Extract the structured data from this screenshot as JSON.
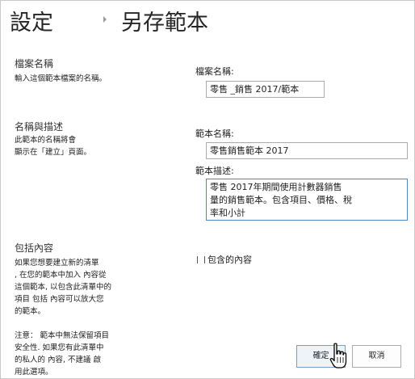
{
  "header": {
    "root": "設定",
    "title": "另存範本"
  },
  "sections": [
    {
      "heading": "檔案名稱",
      "description": [
        "輸入這個範本檔案的名稱。"
      ]
    },
    {
      "heading": "名稱與描述",
      "description": [
        "此範本的名稱將會",
        "顯示在「建立」頁面。"
      ]
    },
    {
      "heading": "包括內容",
      "description": [
        "如果您想要建立新的清單",
        ", 在您的範本中加入 內容從",
        "這個範本, 以包含此清單中的",
        "項目 包括 內容可以放大您",
        "的範本。",
        "",
        "注意：  範本中無法保留項目",
        "安全性. 如果您有此清單中",
        "的私人的 內容, 不建議 啟",
        "用此選項。"
      ]
    }
  ],
  "fields": {
    "file_name": {
      "label": "檔案名稱:",
      "value": "零售 _銷售 2017/範本"
    },
    "template_name": {
      "label": "範本名稱:",
      "value": "零售銷售範本 2017"
    },
    "template_description": {
      "label": "範本描述:",
      "lines": [
        "零售 2017年期間使用計數器銷售",
        "量的銷售範本。包含項目、價格、稅",
        "率和小計"
      ]
    },
    "include_content": {
      "label": "包含的內容",
      "checked": false
    }
  },
  "buttons": {
    "ok": "確定",
    "cancel": "取消"
  },
  "colors": {
    "focus_border": "#4a86c8",
    "input_border": "#ababab"
  },
  "icons": {
    "separator": "chevron-right-icon",
    "pointer": "hand-pointer-icon"
  }
}
